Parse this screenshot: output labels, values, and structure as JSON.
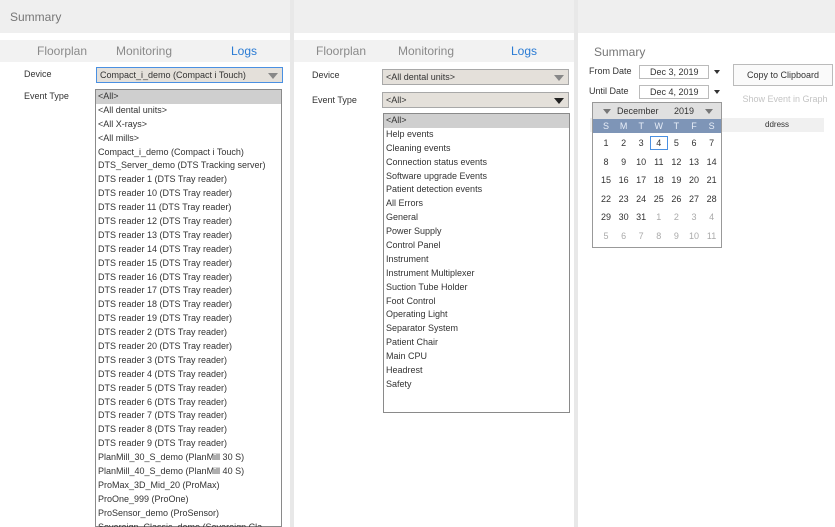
{
  "panel1": {
    "summary_title": "Summary",
    "tabs": [
      "Floorplan",
      "Monitoring",
      "Logs"
    ],
    "device_label": "Device",
    "device_value": "Compact_i_demo (Compact i Touch)",
    "event_type_label": "Event Type",
    "device_options": [
      "<All>",
      "<All dental units>",
      "<All X-rays>",
      "<All mills>",
      "Compact_i_demo (Compact i Touch)",
      "DTS_Server_demo (DTS Tracking server)",
      "DTS reader 1 (DTS Tray reader)",
      "DTS reader 10 (DTS Tray reader)",
      "DTS reader 11 (DTS Tray reader)",
      "DTS reader 12 (DTS Tray reader)",
      "DTS reader 13 (DTS Tray reader)",
      "DTS reader 14 (DTS Tray reader)",
      "DTS reader 15 (DTS Tray reader)",
      "DTS reader 16 (DTS Tray reader)",
      "DTS reader 17 (DTS Tray reader)",
      "DTS reader 18 (DTS Tray reader)",
      "DTS reader 19 (DTS Tray reader)",
      "DTS reader 2 (DTS Tray reader)",
      "DTS reader 20 (DTS Tray reader)",
      "DTS reader 3 (DTS Tray reader)",
      "DTS reader 4 (DTS Tray reader)",
      "DTS reader 5 (DTS Tray reader)",
      "DTS reader 6 (DTS Tray reader)",
      "DTS reader 7 (DTS Tray reader)",
      "DTS reader 8 (DTS Tray reader)",
      "DTS reader 9 (DTS Tray reader)",
      "PlanMill_30_S_demo (PlanMill 30 S)",
      "PlanMill_40_S_demo (PlanMill 40 S)",
      "ProMax_3D_Mid_20 (ProMax)",
      "ProOne_999 (ProOne)",
      "ProSensor_demo (ProSensor)",
      "Sovereign_Classic_demo (Sovereign Cla"
    ]
  },
  "panel2": {
    "tabs": [
      "Floorplan",
      "Monitoring",
      "Logs"
    ],
    "device_label": "Device",
    "device_value": "<All dental units>",
    "event_type_label": "Event Type",
    "event_type_value": "<All>",
    "event_options": [
      "<All>",
      "Help events",
      "Cleaning events",
      "Connection status events",
      "Software upgrade Events",
      "Patient detection events",
      "All Errors",
      "General",
      "Power Supply",
      "Control Panel",
      "Instrument",
      "Instrument Multiplexer",
      "Suction Tube Holder",
      "Foot Control",
      "Operating Light",
      "Separator System",
      "Patient Chair",
      "Main CPU",
      "Headrest",
      "Safety"
    ]
  },
  "panel3": {
    "summary_title": "Summary",
    "from_label": "From Date",
    "from_value": "Dec 3, 2019",
    "until_label": "Until Date",
    "until_value": "Dec 4, 2019",
    "copy_button": "Copy to Clipboard",
    "show_event_button": "Show Event in Graph",
    "address_header": "ddress",
    "calendar": {
      "month": "December",
      "year": "2019",
      "weekdays": [
        "S",
        "M",
        "T",
        "W",
        "T",
        "F",
        "S"
      ],
      "weeks": [
        [
          "1",
          "2",
          "3",
          "4",
          "5",
          "6",
          "7"
        ],
        [
          "8",
          "9",
          "10",
          "11",
          "12",
          "13",
          "14"
        ],
        [
          "15",
          "16",
          "17",
          "18",
          "19",
          "20",
          "21"
        ],
        [
          "22",
          "23",
          "24",
          "25",
          "26",
          "27",
          "28"
        ],
        [
          "29",
          "30",
          "31",
          "1",
          "2",
          "3",
          "4"
        ],
        [
          "5",
          "6",
          "7",
          "8",
          "9",
          "10",
          "11"
        ]
      ],
      "selected_day": "4"
    }
  }
}
